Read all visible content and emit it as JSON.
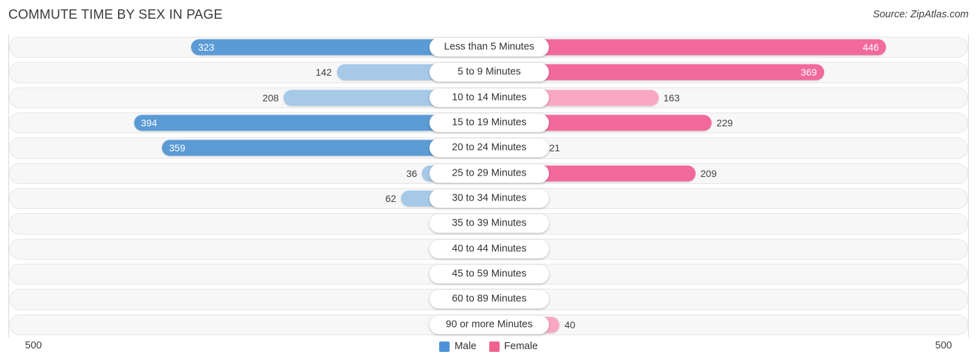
{
  "header": {
    "title": "COMMUTE TIME BY SEX IN PAGE",
    "source": "Source: ZipAtlas.com"
  },
  "legend": {
    "items": [
      {
        "label": "Male",
        "color": "#4e93d9"
      },
      {
        "label": "Female",
        "color": "#f0628f"
      }
    ]
  },
  "axis": {
    "left_label": "500",
    "right_label": "500",
    "max": 500
  },
  "colors": {
    "male_strong": "#5b9bd5",
    "male_light": "#a6c9e8",
    "female_strong": "#f2699c",
    "female_light": "#f9a8c4",
    "track": "#f7f7f7",
    "track_border": "#e6e6e6"
  },
  "chart_data": {
    "type": "bar",
    "orientation": "diverging-horizontal",
    "title": "COMMUTE TIME BY SEX IN PAGE",
    "xlabel": "",
    "ylabel": "",
    "xlim": [
      500,
      500
    ],
    "grid": false,
    "legend_position": "bottom-center",
    "categories": [
      "Less than 5 Minutes",
      "5 to 9 Minutes",
      "10 to 14 Minutes",
      "15 to 19 Minutes",
      "20 to 24 Minutes",
      "25 to 29 Minutes",
      "30 to 34 Minutes",
      "35 to 39 Minutes",
      "40 to 44 Minutes",
      "45 to 59 Minutes",
      "60 to 89 Minutes",
      "90 or more Minutes"
    ],
    "series": [
      {
        "name": "Male",
        "side": "left",
        "values": [
          323,
          142,
          208,
          394,
          359,
          36,
          62,
          0,
          0,
          0,
          0,
          0
        ]
      },
      {
        "name": "Female",
        "side": "right",
        "values": [
          446,
          369,
          163,
          229,
          21,
          209,
          0,
          0,
          0,
          0,
          0,
          40
        ]
      }
    ],
    "rows": [
      {
        "category": "Less than 5 Minutes",
        "male": 323,
        "female": 446,
        "male_text": "323",
        "female_text": "446"
      },
      {
        "category": "5 to 9 Minutes",
        "male": 142,
        "female": 369,
        "male_text": "142",
        "female_text": "369"
      },
      {
        "category": "10 to 14 Minutes",
        "male": 208,
        "female": 163,
        "male_text": "208",
        "female_text": "163"
      },
      {
        "category": "15 to 19 Minutes",
        "male": 394,
        "female": 229,
        "male_text": "394",
        "female_text": "229"
      },
      {
        "category": "20 to 24 Minutes",
        "male": 359,
        "female": 21,
        "male_text": "359",
        "female_text": "21"
      },
      {
        "category": "25 to 29 Minutes",
        "male": 36,
        "female": 209,
        "male_text": "36",
        "female_text": "209"
      },
      {
        "category": "30 to 34 Minutes",
        "male": 62,
        "female": 0,
        "male_text": "62",
        "female_text": "0"
      },
      {
        "category": "35 to 39 Minutes",
        "male": 0,
        "female": 0,
        "male_text": "0",
        "female_text": "0"
      },
      {
        "category": "40 to 44 Minutes",
        "male": 0,
        "female": 0,
        "male_text": "0",
        "female_text": "0"
      },
      {
        "category": "45 to 59 Minutes",
        "male": 0,
        "female": 0,
        "male_text": "0",
        "female_text": "0"
      },
      {
        "category": "60 to 89 Minutes",
        "male": 0,
        "female": 0,
        "male_text": "0",
        "female_text": "0"
      },
      {
        "category": "90 or more Minutes",
        "male": 0,
        "female": 40,
        "male_text": "0",
        "female_text": "40"
      }
    ]
  }
}
